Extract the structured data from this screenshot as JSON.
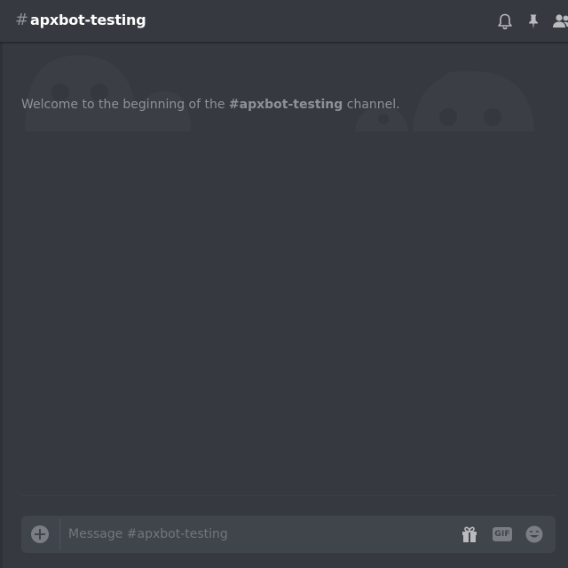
{
  "header": {
    "hash_symbol": "#",
    "channel_name": "apxbot-testing",
    "icons": [
      "bell-icon",
      "pin-icon",
      "members-icon"
    ]
  },
  "welcome": {
    "prefix": "Welcome to the beginning of the ",
    "channel": "#apxbot-testing",
    "suffix": " channel."
  },
  "composer": {
    "placeholder": "Message #apxbot-testing",
    "gif_label": "GIF",
    "icons": [
      "add-attachment-icon",
      "gift-icon",
      "gif-icon",
      "emoji-icon"
    ]
  },
  "colors": {
    "background": "#36393f",
    "header_text": "#ffffff",
    "muted_text": "#8e9297",
    "input_background": "#40444b",
    "icon": "#b9bbbe"
  }
}
